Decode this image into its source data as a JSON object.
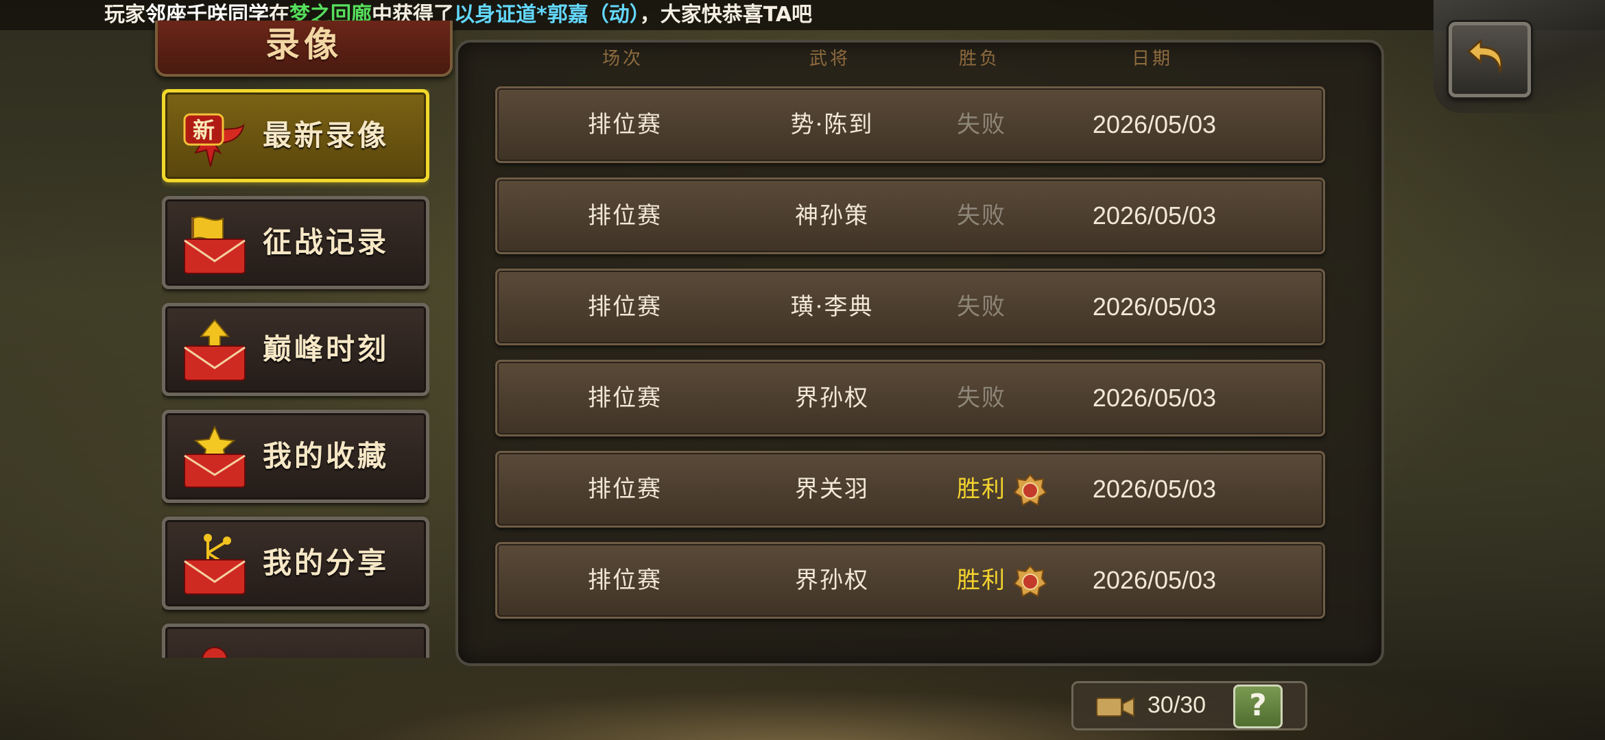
{
  "marquee": {
    "prefix": "玩家",
    "player": "邻座千咲同学",
    "mid1": "在",
    "location": "梦之回廊",
    "mid2": "中获得了",
    "item": "以身证道*郭嘉（动）",
    "suffix": "，大家快恭喜TA吧"
  },
  "title": "录像",
  "menu": [
    {
      "label": "最新录像",
      "icon": "new-ribbon-icon",
      "active": true
    },
    {
      "label": "征战记录",
      "icon": "flag-envelope-icon",
      "active": false
    },
    {
      "label": "巅峰时刻",
      "icon": "arrow-envelope-icon",
      "active": false
    },
    {
      "label": "我的收藏",
      "icon": "star-envelope-icon",
      "active": false
    },
    {
      "label": "我的分享",
      "icon": "share-envelope-icon",
      "active": false
    }
  ],
  "table": {
    "headers": {
      "type": "场次",
      "hero": "武将",
      "result": "胜负",
      "date": "日期"
    },
    "rows": [
      {
        "type": "排位赛",
        "hero": "势·陈到",
        "result": "失败",
        "win": false,
        "date": "2026/05/03"
      },
      {
        "type": "排位赛",
        "hero": "神孙策",
        "result": "失败",
        "win": false,
        "date": "2026/05/03"
      },
      {
        "type": "排位赛",
        "hero": "璜·李典",
        "result": "失败",
        "win": false,
        "date": "2026/05/03"
      },
      {
        "type": "排位赛",
        "hero": "界孙权",
        "result": "失败",
        "win": false,
        "date": "2026/05/03"
      },
      {
        "type": "排位赛",
        "hero": "界关羽",
        "result": "胜利",
        "win": true,
        "date": "2026/05/03"
      },
      {
        "type": "排位赛",
        "hero": "界孙权",
        "result": "胜利",
        "win": true,
        "date": "2026/05/03"
      }
    ]
  },
  "counter": {
    "value": "30/30",
    "icon": "video-camera-icon"
  },
  "help": {
    "label": "?"
  },
  "colors": {
    "win": "#f4d42e",
    "lose": "#8d8578",
    "active_border": "#f1d82a"
  }
}
